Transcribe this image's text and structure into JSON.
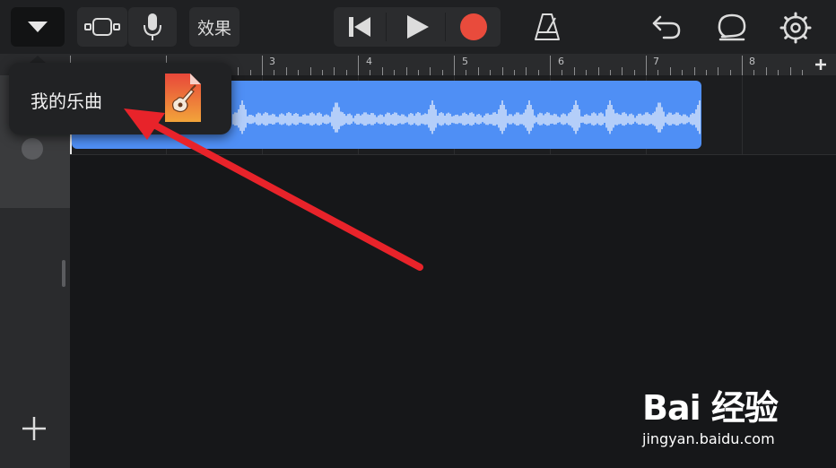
{
  "toolbar": {
    "effects_label": "效果",
    "icons": [
      "dropdown-triangle-icon",
      "tracks-view-icon",
      "microphone-icon",
      "go-to-beginning-icon",
      "play-icon",
      "record-icon",
      "metronome-icon",
      "undo-icon",
      "loop-browser-icon",
      "settings-gear-icon"
    ],
    "record_color": "#e94b3c"
  },
  "ruler": {
    "bars": [
      "3",
      "4",
      "5",
      "6",
      "7",
      "8"
    ]
  },
  "region": {
    "color": "#4f8ff5"
  },
  "popup": {
    "title": "我的乐曲",
    "icon": "garageband-file-icon"
  },
  "annotation": {
    "arrow_color": "#e8232a"
  },
  "watermark": {
    "brand": "Bai 经验",
    "url": "jingyan.baidu.com"
  }
}
